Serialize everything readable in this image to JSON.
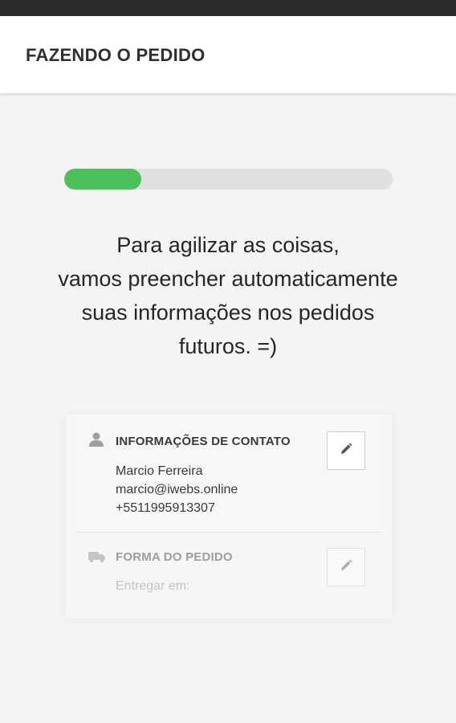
{
  "header": {
    "title": "FAZENDO O PEDIDO"
  },
  "progress": {
    "fraction": 0.235,
    "color": "#4cc05a"
  },
  "intro": {
    "lines": [
      "Para agilizar as coisas,",
      "vamos preencher automaticamente",
      "suas informações nos pedidos",
      "futuros. =)"
    ]
  },
  "contact": {
    "title": "INFORMAÇÕES DE CONTATO",
    "icon": "person-icon",
    "name": "Marcio Ferreira",
    "email": "marcio@iwebs.online",
    "phone": "+5511995913307",
    "edit_icon": "pencil-icon"
  },
  "order": {
    "title": "FORMA DO PEDIDO",
    "icon": "delivery-truck-icon",
    "placeholder": "Entregar em:",
    "edit_icon": "pencil-icon"
  }
}
